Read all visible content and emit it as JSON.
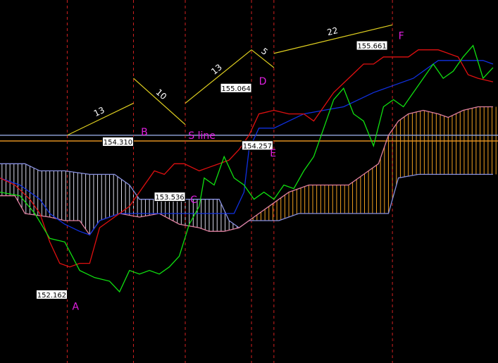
{
  "colors": {
    "background": "#000000",
    "conversion_line": "#e01010",
    "base_line": "#1030e0",
    "lagging_span": "#10e010",
    "span_a": "#e080a0",
    "span_b": "#8890e0",
    "cloud_up_fill": "#f0a020",
    "cloud_down_fill": "#d8d8e8",
    "time_lines": "#d02020",
    "wave_lines": "#e0d020",
    "s_line": "#8899cc",
    "orange_line": "#e09020",
    "markers": "#e020e0"
  },
  "chart_data": {
    "type": "line",
    "title": "",
    "xlabel": "",
    "ylabel": "",
    "ylim": [
      151.2,
      156.3
    ],
    "xlim": [
      0,
      100
    ],
    "grid": false,
    "legend": "none",
    "series": [
      {
        "key": "lagging",
        "values": [
          [
            0,
            153.6
          ],
          [
            4,
            153.55
          ],
          [
            7,
            153.3
          ],
          [
            10,
            152.95
          ],
          [
            13,
            152.9
          ],
          [
            16,
            152.5
          ],
          [
            19,
            152.4
          ],
          [
            22,
            152.35
          ],
          [
            24,
            152.2
          ],
          [
            26,
            152.5
          ],
          [
            28,
            152.45
          ],
          [
            30,
            152.5
          ],
          [
            32,
            152.45
          ],
          [
            34,
            152.55
          ],
          [
            36,
            152.7
          ],
          [
            38,
            153.15
          ],
          [
            40,
            153.4
          ],
          [
            41,
            153.8
          ],
          [
            43,
            153.7
          ],
          [
            45,
            154.1
          ],
          [
            47,
            153.8
          ],
          [
            49,
            153.7
          ],
          [
            51,
            153.5
          ],
          [
            53,
            153.6
          ],
          [
            55,
            153.5
          ],
          [
            57,
            153.7
          ],
          [
            59,
            153.65
          ],
          [
            61,
            153.9
          ],
          [
            63,
            154.1
          ],
          [
            65,
            154.5
          ],
          [
            67,
            154.9
          ],
          [
            69,
            155.06
          ],
          [
            71,
            154.7
          ],
          [
            73,
            154.6
          ],
          [
            75,
            154.25
          ],
          [
            77,
            154.8
          ],
          [
            79,
            154.9
          ],
          [
            81,
            154.8
          ],
          [
            83,
            155.0
          ],
          [
            85,
            155.2
          ],
          [
            87,
            155.4
          ],
          [
            89,
            155.2
          ],
          [
            91,
            155.3
          ],
          [
            93,
            155.5
          ],
          [
            95,
            155.66
          ],
          [
            97,
            155.2
          ],
          [
            99,
            155.35
          ]
        ]
      },
      {
        "key": "conversion",
        "values": [
          [
            0,
            153.8
          ],
          [
            3,
            153.7
          ],
          [
            6,
            153.5
          ],
          [
            8,
            153.3
          ],
          [
            10,
            152.9
          ],
          [
            12,
            152.6
          ],
          [
            14,
            152.55
          ],
          [
            16,
            152.6
          ],
          [
            18,
            152.6
          ],
          [
            20,
            153.1
          ],
          [
            22,
            153.2
          ],
          [
            24,
            153.3
          ],
          [
            26,
            153.4
          ],
          [
            29,
            153.7
          ],
          [
            31,
            153.9
          ],
          [
            33,
            153.85
          ],
          [
            35,
            154.0
          ],
          [
            37,
            154.0
          ],
          [
            40,
            153.9
          ],
          [
            42,
            153.95
          ],
          [
            44,
            154.0
          ],
          [
            46,
            154.05
          ],
          [
            48,
            154.2
          ],
          [
            50,
            154.4
          ],
          [
            52,
            154.7
          ],
          [
            55,
            154.75
          ],
          [
            58,
            154.7
          ],
          [
            61,
            154.7
          ],
          [
            63,
            154.6
          ],
          [
            65,
            154.8
          ],
          [
            67,
            155.0
          ],
          [
            70,
            155.2
          ],
          [
            73,
            155.4
          ],
          [
            75,
            155.4
          ],
          [
            77,
            155.5
          ],
          [
            79,
            155.5
          ],
          [
            82,
            155.5
          ],
          [
            84,
            155.6
          ],
          [
            86,
            155.6
          ],
          [
            88,
            155.6
          ],
          [
            90,
            155.55
          ],
          [
            92,
            155.5
          ],
          [
            94,
            155.25
          ],
          [
            96,
            155.2
          ],
          [
            99,
            155.15
          ]
        ]
      },
      {
        "key": "base",
        "values": [
          [
            0,
            153.8
          ],
          [
            4,
            153.7
          ],
          [
            8,
            153.5
          ],
          [
            10,
            153.3
          ],
          [
            13,
            153.15
          ],
          [
            16,
            153.05
          ],
          [
            18,
            153.0
          ],
          [
            20,
            153.2
          ],
          [
            24,
            153.3
          ],
          [
            28,
            153.3
          ],
          [
            32,
            153.3
          ],
          [
            36,
            153.3
          ],
          [
            40,
            153.3
          ],
          [
            43,
            153.3
          ],
          [
            45,
            153.3
          ],
          [
            47,
            153.3
          ],
          [
            49,
            153.6
          ],
          [
            50,
            154.2
          ],
          [
            52,
            154.5
          ],
          [
            55,
            154.5
          ],
          [
            58,
            154.6
          ],
          [
            61,
            154.7
          ],
          [
            65,
            154.75
          ],
          [
            69,
            154.8
          ],
          [
            72,
            154.9
          ],
          [
            75,
            155.0
          ],
          [
            79,
            155.1
          ],
          [
            83,
            155.2
          ],
          [
            86,
            155.35
          ],
          [
            88,
            155.45
          ],
          [
            90,
            155.45
          ],
          [
            92,
            155.45
          ],
          [
            94,
            155.45
          ],
          [
            97,
            155.45
          ],
          [
            99,
            155.4
          ]
        ]
      },
      {
        "key": "span_a",
        "values": [
          [
            0,
            153.55
          ],
          [
            3,
            153.55
          ],
          [
            5,
            153.3
          ],
          [
            10,
            153.25
          ],
          [
            13,
            153.2
          ],
          [
            16,
            153.2
          ],
          [
            18,
            153.0
          ],
          [
            20,
            153.2
          ],
          [
            24,
            153.3
          ],
          [
            28,
            153.25
          ],
          [
            32,
            153.3
          ],
          [
            36,
            153.15
          ],
          [
            40,
            153.1
          ],
          [
            42,
            153.05
          ],
          [
            45,
            153.05
          ],
          [
            48,
            153.1
          ],
          [
            50,
            153.2
          ],
          [
            52,
            153.3
          ],
          [
            54,
            153.4
          ],
          [
            56,
            153.5
          ],
          [
            58,
            153.6
          ],
          [
            60,
            153.65
          ],
          [
            62,
            153.7
          ],
          [
            65,
            153.7
          ],
          [
            70,
            153.7
          ],
          [
            72,
            153.8
          ],
          [
            74,
            153.9
          ],
          [
            76,
            154.0
          ],
          [
            78,
            154.4
          ],
          [
            80,
            154.6
          ],
          [
            82,
            154.7
          ],
          [
            85,
            154.75
          ],
          [
            88,
            154.7
          ],
          [
            90,
            154.65
          ],
          [
            93,
            154.75
          ],
          [
            96,
            154.8
          ],
          [
            99,
            154.8
          ]
        ]
      },
      {
        "key": "span_b",
        "values": [
          [
            0,
            154.0
          ],
          [
            5,
            154.0
          ],
          [
            8,
            153.9
          ],
          [
            13,
            153.9
          ],
          [
            18,
            153.85
          ],
          [
            23,
            153.85
          ],
          [
            26,
            153.7
          ],
          [
            28,
            153.5
          ],
          [
            32,
            153.5
          ],
          [
            36,
            153.5
          ],
          [
            40,
            153.5
          ],
          [
            44,
            153.5
          ],
          [
            46,
            153.2
          ],
          [
            48,
            153.1
          ],
          [
            50,
            153.2
          ],
          [
            53,
            153.2
          ],
          [
            56,
            153.2
          ],
          [
            60,
            153.3
          ],
          [
            65,
            153.3
          ],
          [
            70,
            153.3
          ],
          [
            75,
            153.3
          ],
          [
            78,
            153.3
          ],
          [
            80,
            153.8
          ],
          [
            84,
            153.85
          ],
          [
            88,
            153.85
          ],
          [
            92,
            153.85
          ],
          [
            96,
            153.85
          ],
          [
            99,
            153.85
          ]
        ]
      }
    ],
    "price_labels": [
      {
        "text": "152.162",
        "x": 13.5,
        "y": 152.162
      },
      {
        "text": "154.310",
        "x": 26.8,
        "y": 154.31
      },
      {
        "text": "153.536",
        "x": 37.2,
        "y": 153.536
      },
      {
        "text": "155.064",
        "x": 50.5,
        "y": 155.064
      },
      {
        "text": "154.257",
        "x": 54.8,
        "y": 154.257
      },
      {
        "text": "155.661",
        "x": 77.8,
        "y": 155.661
      }
    ],
    "markers": [
      {
        "text": "A",
        "x": 14.5,
        "y": 151.95
      },
      {
        "text": "B",
        "x": 28.3,
        "y": 154.4
      },
      {
        "text": "C",
        "x": 38.2,
        "y": 153.45
      },
      {
        "text": "D",
        "x": 52.0,
        "y": 155.11
      },
      {
        "text": "E",
        "x": 54.2,
        "y": 154.1
      },
      {
        "text": "F",
        "x": 80.0,
        "y": 155.75
      }
    ],
    "time_lines_x": [
      13.5,
      26.8,
      37.2,
      50.5,
      55.0,
      78.8
    ],
    "wave_segments": [
      {
        "from": [
          13.5,
          154.4
        ],
        "to": [
          26.8,
          154.85
        ],
        "count": "13"
      },
      {
        "from": [
          26.8,
          155.2
        ],
        "to": [
          37.2,
          154.55
        ],
        "count": "10"
      },
      {
        "from": [
          37.2,
          154.85
        ],
        "to": [
          50.5,
          155.6
        ],
        "count": "13"
      },
      {
        "from": [
          50.5,
          155.6
        ],
        "to": [
          55.0,
          155.35
        ],
        "count": "5"
      },
      {
        "from": [
          55.0,
          155.55
        ],
        "to": [
          78.8,
          155.95
        ],
        "count": "22"
      }
    ],
    "s_line": {
      "y": 154.4,
      "label": "S line"
    },
    "orange_line": {
      "y": 154.32
    }
  }
}
